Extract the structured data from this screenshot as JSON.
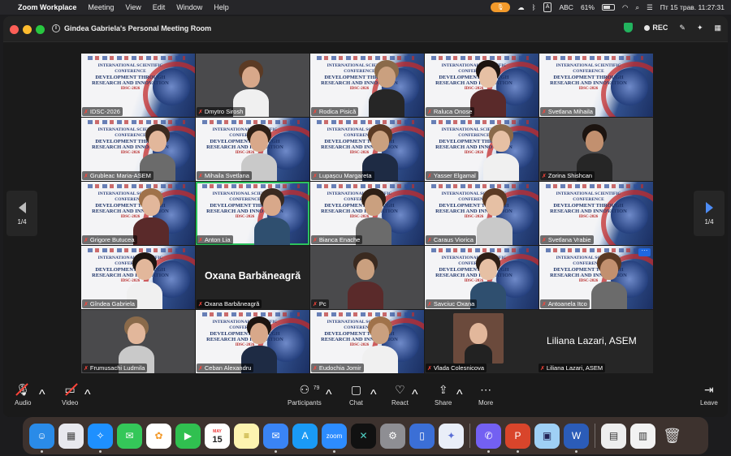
{
  "menubar": {
    "app_name": "Zoom Workplace",
    "menus": [
      "Meeting",
      "View",
      "Edit",
      "Window",
      "Help"
    ],
    "input_source": "ABC",
    "battery": "61%",
    "datetime": "Пт 15 трав.  11:27:31"
  },
  "window": {
    "meeting_title": "Gindea Gabriela's Personal Meeting Room",
    "rec_label": "REC"
  },
  "slide": {
    "conf_line1": "INTERNATIONAL SCIENTIFIC",
    "conf_line2": "CONFERENCE",
    "title_line1": "DEVELOPMENT THROUGH",
    "title_line2": "RESEARCH AND INNOVATION",
    "edition": "IDSC-2026"
  },
  "participants": [
    {
      "name": "IDSC-2026",
      "kind": "slide"
    },
    {
      "name": "Dmytro Sirosh",
      "kind": "photo"
    },
    {
      "name": "Rodica Pisică",
      "kind": "slide-person"
    },
    {
      "name": "Raluca Onose",
      "kind": "slide-person"
    },
    {
      "name": "Svetlana Mihaila",
      "kind": "slide"
    },
    {
      "name": "Grubleac Maria-ASEM",
      "kind": "slide-person"
    },
    {
      "name": "Mihaila Svetlana",
      "kind": "slide-person"
    },
    {
      "name": "Lupașcu Margareta",
      "kind": "slide-person"
    },
    {
      "name": "Yasser Elgamal",
      "kind": "slide-person"
    },
    {
      "name": "Zorina Shishcan",
      "kind": "photo"
    },
    {
      "name": "Grigore Butucea",
      "kind": "slide-person"
    },
    {
      "name": "Anton Lia",
      "kind": "slide-person",
      "active": true
    },
    {
      "name": "Bianca Enache",
      "kind": "slide-person"
    },
    {
      "name": "Caraus Viorica",
      "kind": "slide-person"
    },
    {
      "name": "Svetlana Vrabie",
      "kind": "slide"
    },
    {
      "name": "Gîndea Gabriela",
      "kind": "slide-person"
    },
    {
      "name": "Oxana Barbăneagră",
      "kind": "name-only",
      "display": "Oxana Barbăneagră"
    },
    {
      "name": "Pc",
      "kind": "photo"
    },
    {
      "name": "Savciuc Oxana",
      "kind": "slide-person"
    },
    {
      "name": "Antoanela Itco",
      "kind": "slide-person"
    },
    {
      "name": "Frumusachi Ludmila",
      "kind": "photo"
    },
    {
      "name": "Ceban Alexandru",
      "kind": "slide-person"
    },
    {
      "name": "Eudochia Jomir",
      "kind": "slide-person"
    },
    {
      "name": "Vlada Colesnicova",
      "kind": "wide",
      "display": "Liliana Lazari, ASEM"
    }
  ],
  "wide_tile": {
    "left_name": "Vlada Colesnicova",
    "display_name": "Liliana Lazari, ASEM",
    "tag_name": "Liliana Lazari, ASEM"
  },
  "pager": {
    "left": "1/4",
    "right": "1/4"
  },
  "toolbar": {
    "audio": "Audio",
    "video": "Video",
    "participants": "Participants",
    "participants_count": "79",
    "chat": "Chat",
    "react": "React",
    "share": "Share",
    "more": "More",
    "leave": "Leave"
  },
  "dock": {
    "calendar_day": "15",
    "calendar_month": "MAY"
  },
  "colors": {
    "active_speaker": "#2dc25e",
    "muted": "#ff453a",
    "accent": "#1f67e0"
  }
}
